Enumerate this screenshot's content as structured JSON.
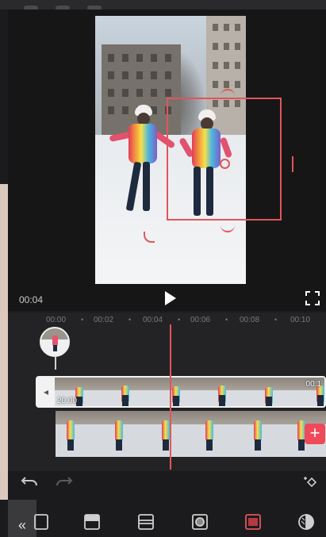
{
  "player": {
    "current_time": "00:04"
  },
  "timeline": {
    "ruler": [
      "00:00",
      "00:02",
      "00:04",
      "00:06",
      "00:08",
      "00:10"
    ],
    "main_track_duration": "00:1",
    "main_track_left_label": "20:00"
  },
  "icons": {
    "play": "play-icon",
    "fullscreen": "fullscreen-icon",
    "undo": "undo-icon",
    "redo": "redo-icon",
    "add_keyframe": "keyframe-add-icon",
    "add_clip": "plus-icon",
    "collapse": "double-chevron-left-icon",
    "tools": [
      "mask-split-icon",
      "mask-top-icon",
      "mask-band-icon",
      "mask-circle-icon",
      "mask-rect-icon",
      "mask-half-icon"
    ]
  },
  "labels": {
    "add_clip": "+",
    "collapse": "«",
    "track_handle": "◂"
  },
  "colors": {
    "accent": "#e2555a",
    "add_button": "#f0495a",
    "background": "#1b1b1d"
  }
}
